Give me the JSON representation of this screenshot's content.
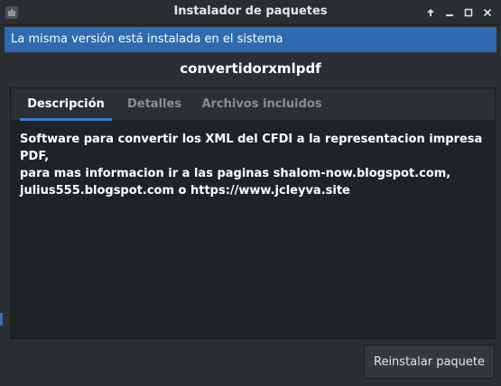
{
  "window": {
    "title": "Instalador de paquetes",
    "icons": [
      "package-icon",
      "arrow-up-icon",
      "minimize-icon",
      "maximize-icon",
      "close-icon"
    ]
  },
  "infobar": {
    "message": "La misma versión está instalada en el sistema"
  },
  "package": {
    "name": "convertidorxmlpdf"
  },
  "tabs": [
    {
      "label": "Descripción",
      "active": true
    },
    {
      "label": "Detalles",
      "active": false
    },
    {
      "label": "Archivos incluidos",
      "active": false
    }
  ],
  "description": {
    "lines": [
      "Software para convertir los XML del CFDI a la representacion impresa PDF,",
      "para mas informacion ir a las paginas shalom-now.blogspot.com,",
      "julius555.blogspot.com o https://www.jcleyva.site"
    ]
  },
  "actions": {
    "reinstall_label": "Reinstalar paquete"
  },
  "colors": {
    "accent": "#3a7bd5",
    "infobar": "#2f6aae",
    "background": "#2b2e33"
  }
}
